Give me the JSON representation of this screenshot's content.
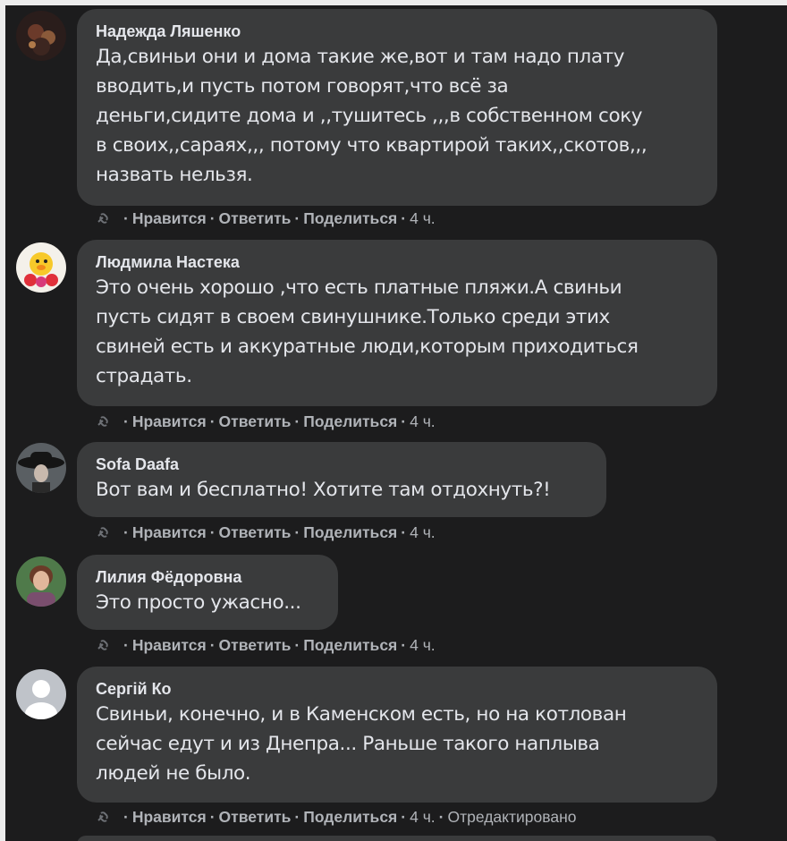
{
  "comments": [
    {
      "author": "Надежда Ляшенко",
      "lines": [
        "Да,свиньи они и дома такие же,вот и там надо плату",
        "вводить,и пусть потом говорят,что всё за",
        "деньги,сидите дома и ,,тушитесь ,,,в собственном соку",
        "в своих,,сараях,,, потому что квартирой таких,,скотов,,,",
        "назвать нельзя."
      ],
      "like": "Нравится",
      "reply": "Ответить",
      "share": "Поделиться",
      "time": "4 ч.",
      "edited": "",
      "avatar_icon": "dark-photo-avatar"
    },
    {
      "author": "Людмила Настека",
      "lines": [
        "Это очень хорошо ,что есть платные пляжи.А свиньи",
        "пусть сидят в своем свинушнике.Только среди этих",
        "свиней есть и аккуратные люди,которым приходиться",
        "страдать."
      ],
      "like": "Нравится",
      "reply": "Ответить",
      "share": "Поделиться",
      "time": "4 ч.",
      "edited": "",
      "avatar_icon": "duck-avatar"
    },
    {
      "author": "Sofa Daafa",
      "lines": [
        "Вот вам и бесплатно! Хотите там отдохнуть?!"
      ],
      "like": "Нравится",
      "reply": "Ответить",
      "share": "Поделиться",
      "time": "4 ч.",
      "edited": "",
      "avatar_icon": "hat-avatar"
    },
    {
      "author": "Лилия Фёдоровна",
      "lines": [
        "Это просто ужасно..."
      ],
      "like": "Нравится",
      "reply": "Ответить",
      "share": "Поделиться",
      "time": "4 ч.",
      "edited": "",
      "avatar_icon": "portrait-avatar"
    },
    {
      "author": "Сергій Ко",
      "lines": [
        "Свиньи, конечно, и в Каменском есть, но на котлован",
        "сейчас едут и из Днепра... Раньше такого наплыва",
        "людей не было."
      ],
      "like": "Нравится",
      "reply": "Ответить",
      "share": "Поделиться",
      "time": "4 ч.",
      "edited": "Отредактировано",
      "avatar_icon": "default-user-avatar"
    }
  ],
  "colors": {
    "background": "#1c1c1d",
    "bubble": "#3a3b3c",
    "text": "#e4e6eb",
    "secondary_text": "#b0b3b8"
  }
}
